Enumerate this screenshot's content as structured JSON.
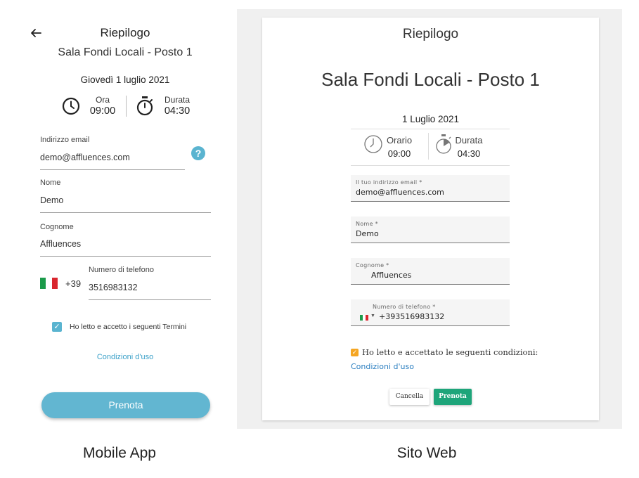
{
  "mobile": {
    "title": "Riepilogo",
    "room": "Sala Fondi Locali - Posto 1",
    "date": "Giovedì 1 luglio 2021",
    "time_label": "Ora",
    "time_value": "09:00",
    "duration_label": "Durata",
    "duration_value": "04:30",
    "email_label": "Indirizzo email",
    "email_value": "demo@affluences.com",
    "help_icon": "?",
    "name_label": "Nome",
    "name_value": "Demo",
    "surname_label": "Cognome",
    "surname_value": "Affluences",
    "phone_label": "Numero di telefono",
    "phone_prefix": "+39",
    "phone_value": "3516983132",
    "terms_checked": true,
    "terms_text": "Ho letto e accetto i seguenti Termini",
    "terms_link": "Condizioni d'uso",
    "book_button": "Prenota",
    "accent_color": "#62b6d1"
  },
  "web": {
    "title": "Riepilogo",
    "room": "Sala Fondi Locali - Posto 1",
    "date": "1 Luglio 2021",
    "time_label": "Orario",
    "time_value": "09:00",
    "duration_label": "Durata",
    "duration_value": "04:30",
    "email_label": "Il tuo indirizzo email *",
    "email_value": "demo@affluences.com",
    "name_label": "Nome *",
    "name_value": "Demo",
    "surname_label": "Cognome *",
    "surname_value": "Affluences",
    "phone_label": "Numero di telefono *",
    "phone_value": "+393516983132",
    "terms_checked": true,
    "terms_text": "Ho letto e accettato le seguenti condizioni:",
    "terms_link": "Condizioni d'uso",
    "cancel_button": "Cancella",
    "book_button": "Prenota",
    "accent_color": "#1ea57a",
    "checkbox_color": "#f5a623"
  },
  "captions": {
    "mobile": "Mobile App",
    "web": "Sito Web"
  },
  "icons": {
    "back": "arrow-left-icon",
    "clock": "clock-icon",
    "stopwatch": "stopwatch-icon",
    "help": "help-circle-icon",
    "flag": "italy-flag-icon",
    "check": "checkmark-icon"
  }
}
